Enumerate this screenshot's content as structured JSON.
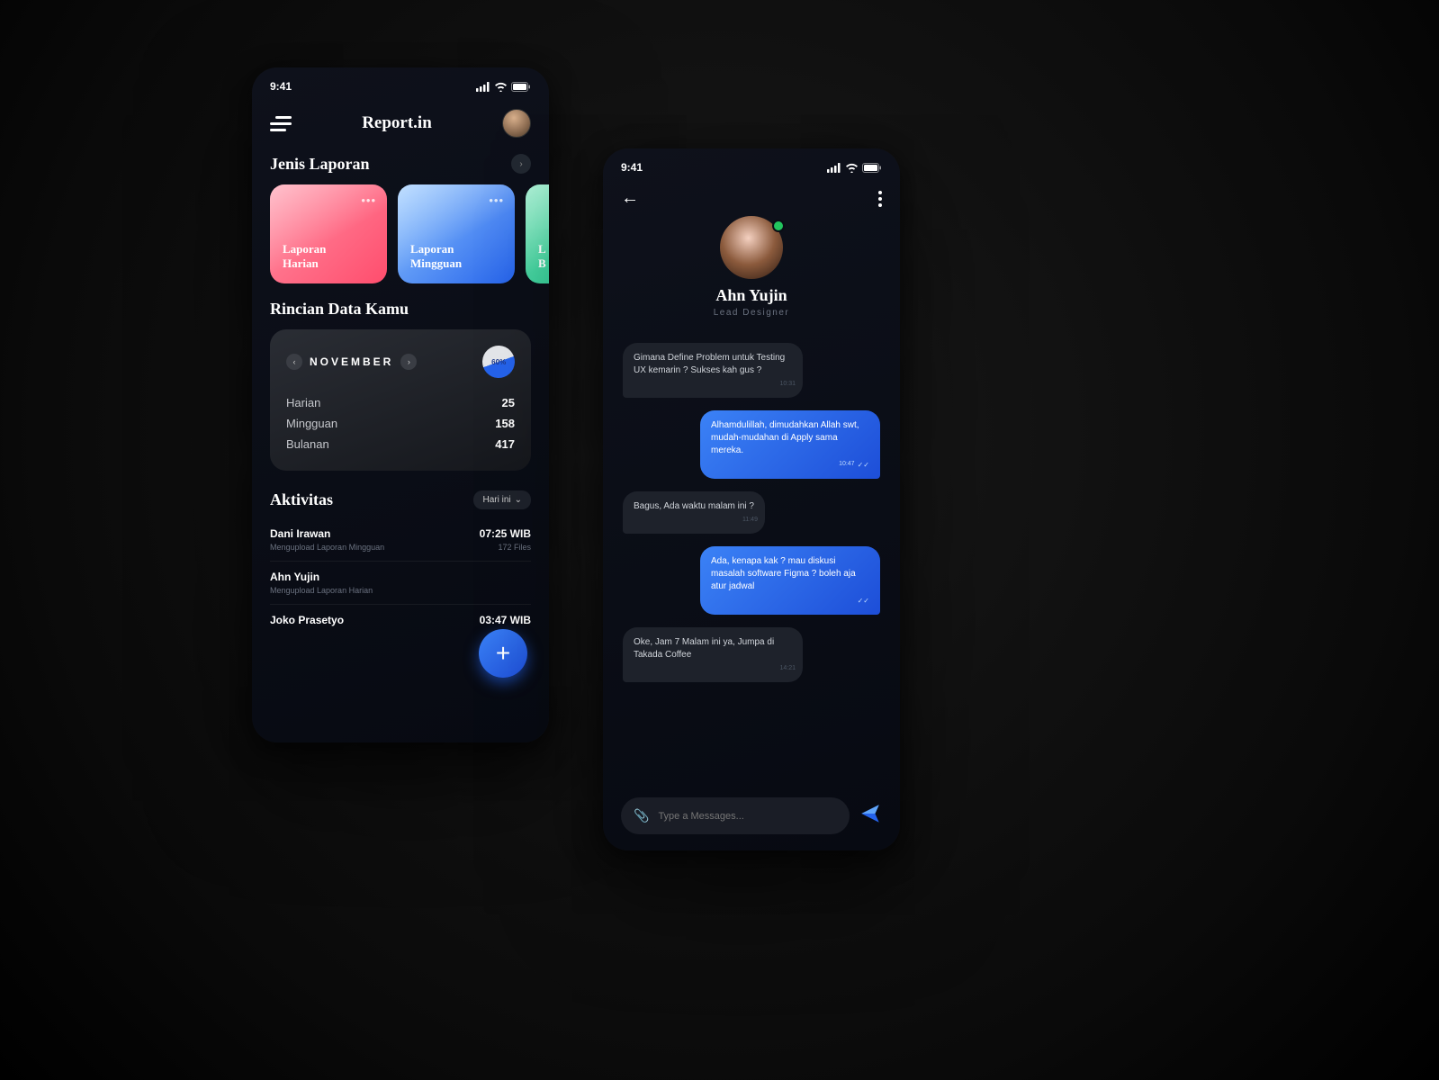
{
  "statusbar": {
    "time": "9:41"
  },
  "phoneA": {
    "title": "Report.in",
    "section1": "Jenis Laporan",
    "cards": [
      {
        "line1": "Laporan",
        "line2": "Harian"
      },
      {
        "line1": "Laporan",
        "line2": "Mingguan"
      },
      {
        "line1": "L",
        "line2": "B"
      }
    ],
    "section2": "Rincian Data Kamu",
    "month": "NOVEMBER",
    "pct": "60%",
    "stats": [
      {
        "label": "Harian",
        "value": "25"
      },
      {
        "label": "Mingguan",
        "value": "158"
      },
      {
        "label": "Bulanan",
        "value": "417"
      }
    ],
    "section3": "Aktivitas",
    "filter": "Hari ini",
    "activities": [
      {
        "name": "Dani Irawan",
        "time": "07:25 WIB",
        "sub": "Mengupload Laporan Mingguan",
        "meta": "172 Files"
      },
      {
        "name": "Ahn Yujin",
        "time": "",
        "sub": "Mengupload Laporan Harian",
        "meta": ""
      },
      {
        "name": "Joko Prasetyo",
        "time": "03:47 WIB",
        "sub": "",
        "meta": ""
      }
    ]
  },
  "phoneB": {
    "name": "Ahn Yujin",
    "role": "Lead Designer",
    "messages": [
      {
        "side": "received",
        "text": "Gimana Define Problem untuk Testing UX kemarin ? Sukses kah gus ?",
        "time": "10:31"
      },
      {
        "side": "sent",
        "text": "Alhamdulillah, dimudahkan Allah swt, mudah-mudahan di Apply sama mereka.",
        "time": "10:47"
      },
      {
        "side": "received",
        "text": "Bagus, Ada waktu malam ini ?",
        "time": "11:49"
      },
      {
        "side": "sent",
        "text": "Ada, kenapa kak ? mau diskusi masalah software Figma ? boleh aja atur jadwal",
        "time": ""
      },
      {
        "side": "received",
        "text": "Oke, Jam 7 Malam ini ya, Jumpa di Takada Coffee",
        "time": "14:21"
      }
    ],
    "placeholder": "Type a Messages..."
  }
}
